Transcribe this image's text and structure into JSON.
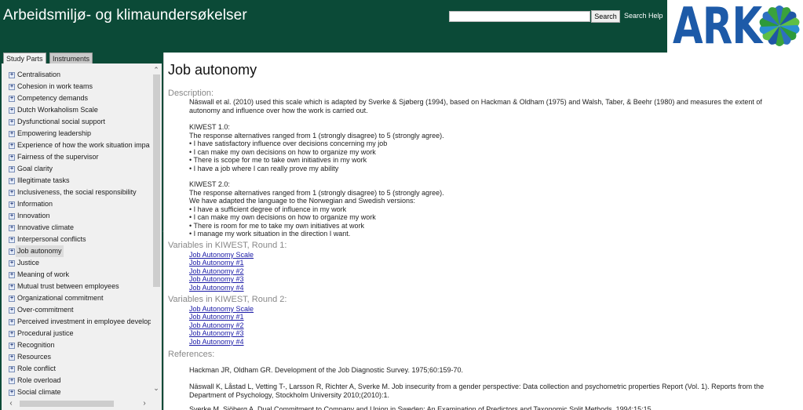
{
  "header": {
    "title": "Arbeidsmiljø- og klimaundersøkelser",
    "search_placeholder": "",
    "search_value": "",
    "search_button": "Search",
    "search_help": "Search Help",
    "logo_text": "ARK",
    "colors": {
      "header_bg": "#0b4a37",
      "logo_blue": "#1d5aa8",
      "logo_green": "#3aa23c"
    }
  },
  "sidebar": {
    "tabs": [
      {
        "label": "Study Parts",
        "active": true
      },
      {
        "label": "Instruments",
        "active": false
      }
    ],
    "items": [
      {
        "label": "Centralisation"
      },
      {
        "label": "Cohesion in work teams"
      },
      {
        "label": "Competency demands"
      },
      {
        "label": "Dutch Workaholism Scale"
      },
      {
        "label": "Dysfunctional social support"
      },
      {
        "label": "Empowering leadership"
      },
      {
        "label": "Experience of how the work situation impa"
      },
      {
        "label": "Fairness of the supervisor"
      },
      {
        "label": "Goal clarity"
      },
      {
        "label": "Illegitimate tasks"
      },
      {
        "label": "Inclusiveness, the social responsibility"
      },
      {
        "label": "Information"
      },
      {
        "label": "Innovation"
      },
      {
        "label": "Innovative climate"
      },
      {
        "label": "Interpersonal conflicts"
      },
      {
        "label": "Job autonomy",
        "selected": true
      },
      {
        "label": "Justice"
      },
      {
        "label": "Meaning of work"
      },
      {
        "label": "Mutual trust between employees"
      },
      {
        "label": "Organizational commitment"
      },
      {
        "label": "Over-commitment"
      },
      {
        "label": "Perceived investment in employee develop"
      },
      {
        "label": "Procedural justice"
      },
      {
        "label": "Recognition"
      },
      {
        "label": "Resources"
      },
      {
        "label": "Role conflict"
      },
      {
        "label": "Role overload"
      },
      {
        "label": "Social climate"
      }
    ],
    "expand_icon": "plus-box-icon"
  },
  "main": {
    "title": "Job autonomy",
    "description_label": "Description:",
    "description_lines": [
      "Näswall et al. (2010) used this scale which is adapted by Sverke & Sjøberg (1994), based on Hackman & Oldham (1975) and Walsh, Taber, & Beehr (1980) and measures the extent of",
      "autonomy and influence over how the work is carried out."
    ],
    "kiwest1": {
      "heading": "KIWEST 1.0:",
      "lines": [
        "The response alternatives ranged from 1 (strongly disagree) to 5 (strongly agree).",
        "• I have satisfactory influence over decisions concerning my job",
        "• I can make my own decisions on how to organize my work",
        "• There is scope for me to take own initiatives in my work",
        "• I have a job where I can really prove my ability"
      ]
    },
    "kiwest2": {
      "heading": "KIWEST 2.0:",
      "lines": [
        "The response alternatives ranged from 1 (strongly disagree) to 5 (strongly agree).",
        "We have adapted the language to the Norwegian and Swedish versions:",
        "• I have a sufficient degree of influence in my work",
        "• I can make my own decisions on how to organize my work",
        "• There is room for me to take my own initiatives at work",
        "• I manage my work situation in the direction I want."
      ]
    },
    "round1_label": "Variables in KIWEST, Round 1:",
    "round1_links": [
      "Job Autonomy Scale",
      "Job Autonomy #1",
      "Job Autonomy #2",
      "Job Autonomy #3",
      "Job Autonomy #4"
    ],
    "round2_label": "Variables in KIWEST, Round 2:",
    "round2_links": [
      "Job Autonomy Scale",
      "Job Autonomy #1",
      "Job Autonomy #2",
      "Job Autonomy #3",
      "Job Autonomy #4"
    ],
    "references_label": "References:",
    "references": [
      [
        "Hackman JR, Oldham GR. Development of the Job Diagnostic Survey. 1975;60:159-70."
      ],
      [
        "Näswall K, Låstad L, Vetting T-, Larsson R, Richter A, Sverke M. Job insecurity from a gender perspective: Data collection and psychometric properties Report (Vol. 1). Reports from the",
        "Department of Psychology, Stockholm University 2010;(2010):1."
      ],
      [
        "Sverke M, Sjöberg A. Dual Commitment to Company and Union in Sweden: An Examination of Predictors and Taxonomic Split Methods. 1994;15:15"
      ]
    ]
  }
}
